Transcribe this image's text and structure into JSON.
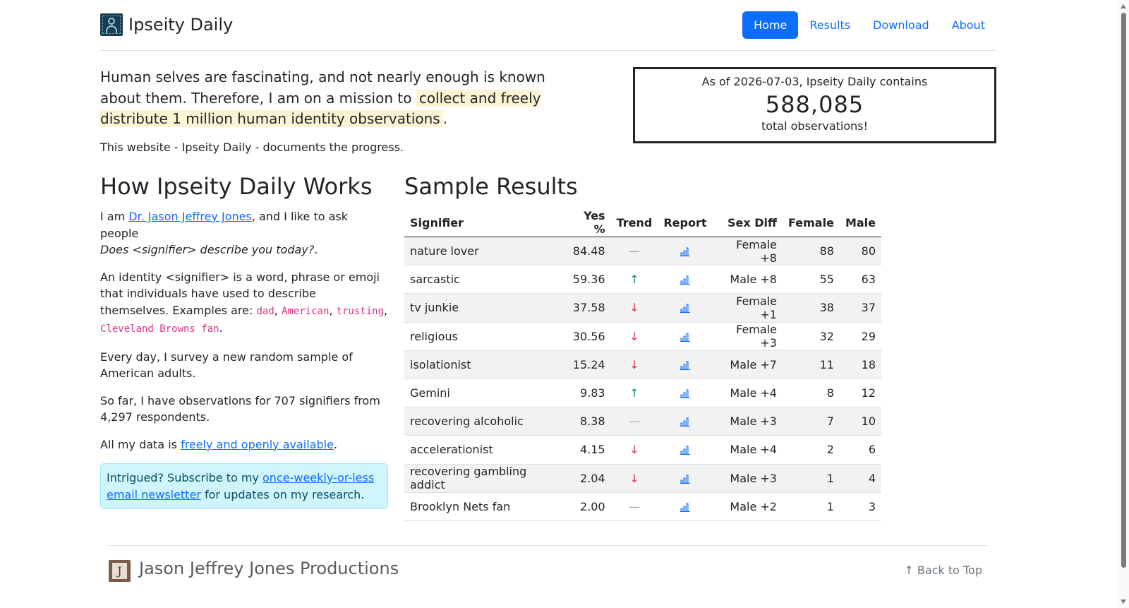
{
  "header": {
    "title": "Ipseity Daily",
    "nav": [
      "Home",
      "Results",
      "Download",
      "About"
    ],
    "active": "Home"
  },
  "hero": {
    "lead_part1": "Human selves are fascinating, and not nearly enough is known about them. Therefore, I am on a mission to ",
    "lead_mark": "collect and freely distribute 1 million human identity observations",
    "lead_part2": ".",
    "sub": "This website - Ipseity Daily - documents the progress."
  },
  "counter": {
    "pre": "As of 2026-07-03, Ipseity Daily contains",
    "number": "588,085",
    "post": "total observations!"
  },
  "how": {
    "heading": "How Ipseity Daily Works",
    "p1_pre": "I am ",
    "p1_link": "Dr. Jason Jeffrey Jones",
    "p1_post": ", and I like to ask people",
    "p1_question": "Does <signifier> describe you today?",
    "p1_end": ".",
    "p2_pre": "An identity <signifier> is a word, phrase or emoji that individuals have used to describe themselves. Examples are: ",
    "examples": [
      "dad",
      "American",
      "trusting",
      "Cleveland Browns fan"
    ],
    "p3": "Every day, I survey a new random sample of American adults.",
    "p4": "So far, I have observations for 707 signifiers from 4,297 respondents.",
    "p5_pre": "All my data is ",
    "p5_link": "freely and openly available",
    "p5_post": ".",
    "alert_pre": "Intrigued? Subscribe to my ",
    "alert_link": "once-weekly-or-less email newsletter",
    "alert_post": " for updates on my research."
  },
  "results": {
    "heading": "Sample Results",
    "columns": [
      "Signifier",
      "Yes %",
      "Trend",
      "Report",
      "Sex Diff",
      "Female",
      "Male"
    ],
    "rows": [
      {
        "signifier": "nature lover",
        "yes": "84.48",
        "trend": "flat",
        "sexdiff": "Female +8",
        "female": "88",
        "male": "80"
      },
      {
        "signifier": "sarcastic",
        "yes": "59.36",
        "trend": "up",
        "sexdiff": "Male +8",
        "female": "55",
        "male": "63"
      },
      {
        "signifier": "tv junkie",
        "yes": "37.58",
        "trend": "down",
        "sexdiff": "Female +1",
        "female": "38",
        "male": "37"
      },
      {
        "signifier": "religious",
        "yes": "30.56",
        "trend": "down",
        "sexdiff": "Female +3",
        "female": "32",
        "male": "29"
      },
      {
        "signifier": "isolationist",
        "yes": "15.24",
        "trend": "down",
        "sexdiff": "Male +7",
        "female": "11",
        "male": "18"
      },
      {
        "signifier": "Gemini",
        "yes": "9.83",
        "trend": "up",
        "sexdiff": "Male +4",
        "female": "8",
        "male": "12"
      },
      {
        "signifier": "recovering alcoholic",
        "yes": "8.38",
        "trend": "flat",
        "sexdiff": "Male +3",
        "female": "7",
        "male": "10"
      },
      {
        "signifier": "accelerationist",
        "yes": "4.15",
        "trend": "down",
        "sexdiff": "Male +4",
        "female": "2",
        "male": "6"
      },
      {
        "signifier": "recovering gambling addict",
        "yes": "2.04",
        "trend": "down",
        "sexdiff": "Male +3",
        "female": "1",
        "male": "4"
      },
      {
        "signifier": "Brooklyn Nets fan",
        "yes": "2.00",
        "trend": "flat",
        "sexdiff": "Male +2",
        "female": "1",
        "male": "3"
      }
    ],
    "trend_glyphs": {
      "up": "↑",
      "down": "↓",
      "flat": "—"
    },
    "icons": {
      "trend": "trend-arrow-icon",
      "report": "bar-chart-icon"
    }
  },
  "footer": {
    "logo_letter": "J",
    "title": "Jason Jeffrey Jones Productions",
    "back_to_top": "↑ Back to Top"
  },
  "colors": {
    "primary": "#0d6efd",
    "up": "#198754",
    "down": "#dc3545",
    "mark": "#fcf3d4",
    "alert_bg": "#cff4fc"
  }
}
